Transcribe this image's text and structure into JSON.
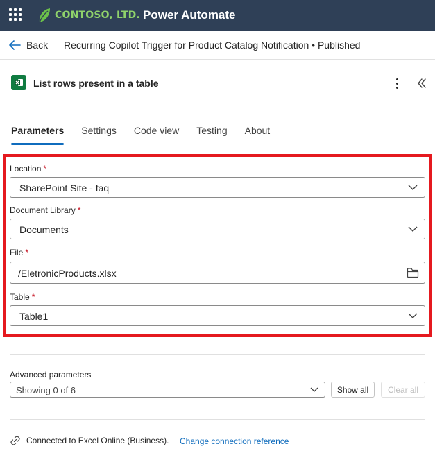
{
  "topbar": {
    "logo_text": "CONTOSO, LTD.",
    "app_name": "Power Automate",
    "background": "#2f4057",
    "logo_color": "#8fd26b"
  },
  "header": {
    "back_label": "Back",
    "flow_title": "Recurring Copilot Trigger for Product Catalog Notification • Published"
  },
  "action": {
    "title": "List rows present in a table",
    "icon": "excel-icon"
  },
  "tabs": [
    {
      "label": "Parameters",
      "active": true
    },
    {
      "label": "Settings",
      "active": false
    },
    {
      "label": "Code view",
      "active": false
    },
    {
      "label": "Testing",
      "active": false
    },
    {
      "label": "About",
      "active": false
    }
  ],
  "fields": {
    "location": {
      "label": "Location",
      "required": "*",
      "value": "SharePoint Site - faq"
    },
    "document_library": {
      "label": "Document Library",
      "required": "*",
      "value": "Documents"
    },
    "file": {
      "label": "File",
      "required": "*",
      "value": "/EletronicProducts.xlsx"
    },
    "table": {
      "label": "Table",
      "required": "*",
      "value": "Table1"
    }
  },
  "advanced": {
    "label": "Advanced parameters",
    "value": "Showing 0 of 6",
    "show_all": "Show all",
    "clear_all": "Clear all"
  },
  "connection": {
    "text": "Connected to Excel Online (Business).",
    "link": "Change connection reference"
  },
  "colors": {
    "accent": "#0f6cbd",
    "highlight": "#e5191f",
    "required": "#c50f1f"
  }
}
